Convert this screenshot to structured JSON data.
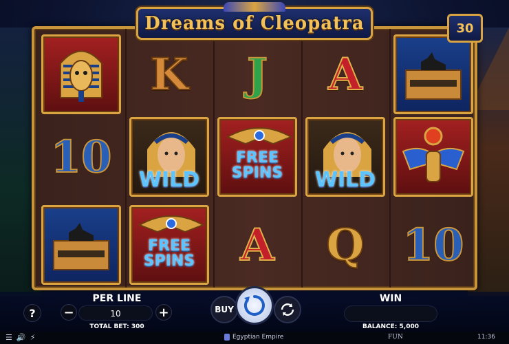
{
  "title": "Dreams of Cleopatra",
  "lines_badge": "30",
  "reels": [
    [
      {
        "symbol": "pharaoh-mask",
        "label": ""
      },
      {
        "symbol": "ten",
        "label": "10"
      },
      {
        "symbol": "anubis-chest",
        "label": ""
      }
    ],
    [
      {
        "symbol": "king",
        "label": "K"
      },
      {
        "symbol": "cleopatra-wild",
        "label": "WILD"
      },
      {
        "symbol": "scarab-free-spins",
        "label": "FREE SPINS"
      }
    ],
    [
      {
        "symbol": "jack",
        "label": "J"
      },
      {
        "symbol": "scarab-free-spins",
        "label": "FREE SPINS"
      },
      {
        "symbol": "ace",
        "label": "A"
      }
    ],
    [
      {
        "symbol": "ace",
        "label": "A"
      },
      {
        "symbol": "cleopatra-wild",
        "label": "WILD"
      },
      {
        "symbol": "queen",
        "label": "Q"
      }
    ],
    [
      {
        "symbol": "anubis-chest",
        "label": ""
      },
      {
        "symbol": "scarab-red",
        "label": ""
      },
      {
        "symbol": "ten",
        "label": "10"
      }
    ]
  ],
  "controls": {
    "help_label": "?",
    "per_line_label": "PER LINE",
    "per_line_value": "10",
    "minus_label": "−",
    "plus_label": "+",
    "total_bet": "TOTAL BET: 300",
    "buy_label": "BUY",
    "win_label": "WIN",
    "win_value": "",
    "balance": "BALANCE: 5,000"
  },
  "footer": {
    "game_name": "Egyptian Empire",
    "mode": "FUN",
    "time": "11:36"
  },
  "colors": {
    "gold": "#d9a441",
    "frame_blue": "#1e2f6e",
    "wild_blue": "#5ec4ff"
  }
}
